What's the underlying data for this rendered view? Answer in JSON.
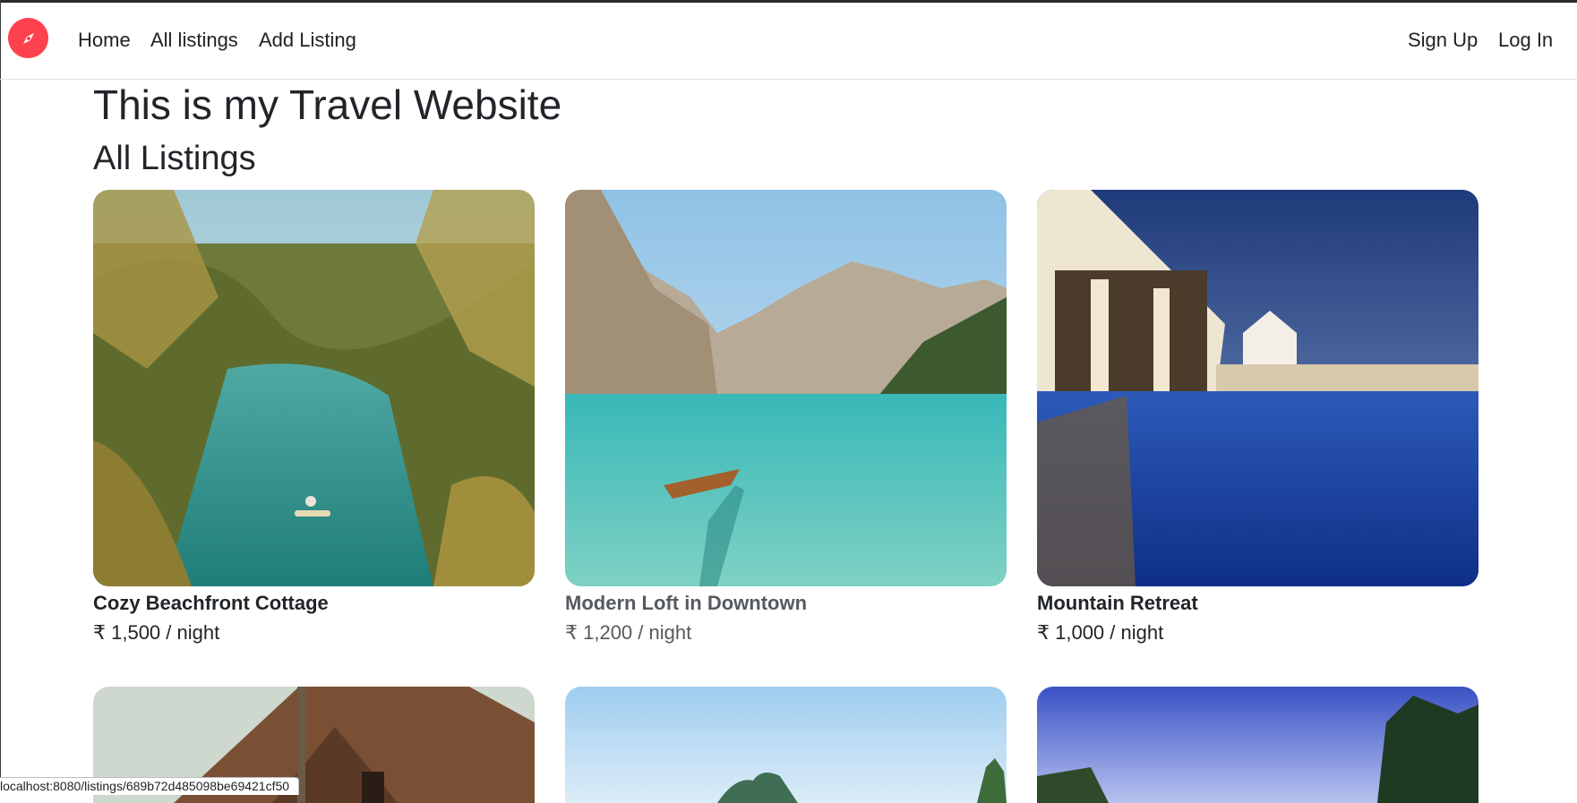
{
  "nav": {
    "logo_icon": "compass-icon",
    "links": [
      "Home",
      "All listings",
      "Add Listing"
    ],
    "auth": {
      "signup": "Sign Up",
      "login": "Log In"
    },
    "brand_color": "#fe424d"
  },
  "main": {
    "site_title": "This is my Travel Website",
    "section_title": "All Listings"
  },
  "listings": [
    {
      "title": "Cozy Beachfront Cottage",
      "price": "₹ 1,500 / night",
      "image": "tropical river with palm trees and a canoe"
    },
    {
      "title": "Modern Loft in Downtown",
      "price": "₹ 1,200 / night",
      "image": "turquoise mountain lake with rowing boat"
    },
    {
      "title": "Mountain Retreat",
      "price": "₹ 1,000 / night",
      "image": "resort pool at dusk"
    },
    {
      "image": "wooden cabin with palm tree"
    },
    {
      "image": "tropical island under blue sky"
    },
    {
      "image": "palm trees at dusk"
    }
  ],
  "status_bar": {
    "url": "localhost:8080/listings/689b72d485098be69421cf50"
  }
}
